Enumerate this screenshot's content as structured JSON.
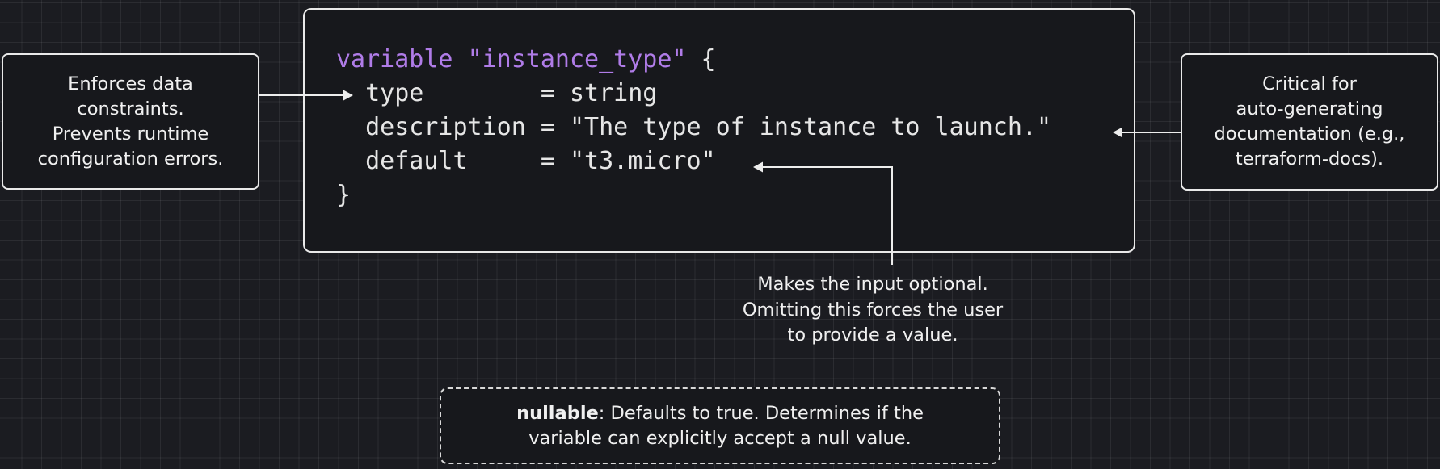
{
  "code_block": {
    "keyword": "variable",
    "name": "\"instance_type\"",
    "open_brace": " {",
    "lines": [
      "  type        = string",
      "  description = \"The type of instance to launch.\"",
      "  default     = \"t3.micro\""
    ],
    "close_brace": "}"
  },
  "annotations": {
    "type_note": {
      "lines": [
        "Enforces data",
        "constraints.",
        "Prevents runtime",
        "configuration errors."
      ]
    },
    "description_note": {
      "lines": [
        "Critical for",
        "auto-generating",
        "documentation (e.g.,",
        "terraform-docs)."
      ]
    },
    "default_note": {
      "lines": [
        "Makes the input optional.",
        "Omitting this forces the user",
        "to provide a value."
      ]
    },
    "nullable_note": {
      "term": "nullable",
      "line1_rest": ": Defaults to true. Determines if the",
      "line2": "variable can explicitly accept a null value."
    }
  },
  "colors": {
    "background": "#1b1c21",
    "keyword": "#b07ce8",
    "text": "#e6e6e6",
    "border": "#e9e9e9"
  }
}
